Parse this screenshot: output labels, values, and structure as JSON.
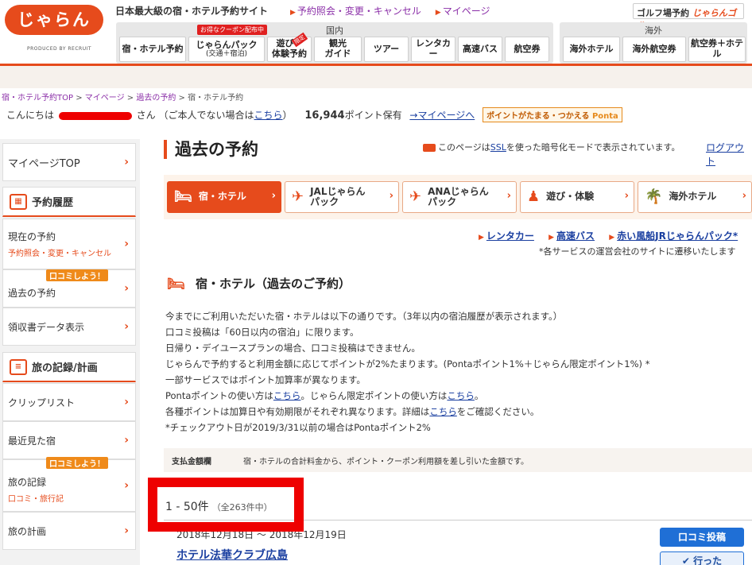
{
  "header": {
    "logo_text": "じゃらん",
    "logo_sub": "PRODUCED BY RECRUIT",
    "tagline": "日本最大級の宿・ホテル予約サイト",
    "top_links": [
      "予約照会・変更・キャンセル",
      "マイページ"
    ],
    "golf_label": "ゴルフ場予約",
    "golf_brand": "じゃらんゴルフ",
    "domestic_label": "国内",
    "overseas_label": "海外",
    "coupon_badge": "お得なクーポン配布中",
    "gen_badge": "限定",
    "domestic_tabs": [
      {
        "label": "宿・ホテル予約",
        "sub": ""
      },
      {
        "label": "じゃらんパック",
        "sub": "(交通＋宿泊)"
      },
      {
        "label": "遊び・",
        "sub": "体験予約"
      },
      {
        "label": "観光",
        "sub": "ガイド"
      },
      {
        "label": "ツアー",
        "sub": ""
      },
      {
        "label": "レンタカー",
        "sub": ""
      },
      {
        "label": "高速バス",
        "sub": ""
      },
      {
        "label": "航空券",
        "sub": ""
      }
    ],
    "overseas_tabs": [
      {
        "label": "海外ホテル"
      },
      {
        "label": "海外航空券"
      },
      {
        "label": "航空券＋ホテル"
      }
    ]
  },
  "breadcrumb": {
    "items": [
      "宿・ホテル予約TOP",
      "マイページ",
      "過去の予約"
    ],
    "current": "宿・ホテル予約",
    "sep": " > "
  },
  "greeting": {
    "hello": "こんにちは",
    "san": "さん",
    "not_you": "（ご本人でない場合は",
    "kochira": "こちら",
    "close": "）",
    "points": "16,944",
    "points_suffix": "ポイント保有",
    "mypage_link": "→マイページへ",
    "ponta_text": "ポイントがたまる・つかえる",
    "ponta_brand": "Ponta"
  },
  "sidebar": {
    "mypage_top": "マイページTOP",
    "section1": "予約履歴",
    "current_res": "現在の予約",
    "current_res_sub": "予約照会・変更・キャンセル",
    "kuchikomi_badge": "口コミしよう！",
    "past_res": "過去の予約",
    "receipt": "領収書データ表示",
    "section2": "旅の記録/計画",
    "clip": "クリップリスト",
    "recent": "最近見た宿",
    "travel_record": "旅の記録",
    "travel_record_sub": "口コミ・旅行記",
    "travel_plan": "旅の計画",
    "chev": "›"
  },
  "main": {
    "title": "過去の予約",
    "ssl_note_pre": "このページは",
    "ssl_link": "SSL",
    "ssl_note_post": "を使った暗号化モードで表示されています。",
    "logout": "ログアウト",
    "service_tabs": [
      {
        "icon": "bed-icon",
        "label1": "宿・ホテル",
        "label2": "",
        "active": true
      },
      {
        "icon": "plane-icon",
        "label1": "JALじゃらん",
        "label2": "パック",
        "active": false
      },
      {
        "icon": "plane-icon",
        "label1": "ANAじゃらん",
        "label2": "パック",
        "active": false
      },
      {
        "icon": "play-icon",
        "label1": "遊び・体験",
        "label2": "",
        "active": false
      },
      {
        "icon": "palm-icon",
        "label1": "海外ホテル",
        "label2": "",
        "active": false
      }
    ],
    "ext_links": [
      "レンタカー",
      "高速バス",
      "赤い風船JRじゃらんパック*"
    ],
    "ext_note": "*各サービスの運営会社のサイトに遷移いたします",
    "section_title": "宿・ホテル（過去のご予約）",
    "notes": [
      "今までにご利用いただいた宿・ホテルは以下の通りです。（3年以内の宿泊履歴が表示されます。）",
      "口コミ投稿は「60日以内の宿泊」に限ります。",
      "日帰り・デイユースプランの場合、口コミ投稿はできません。",
      "じゃらんで予約すると利用金額に応じてポイントが2%たまります。(Pontaポイント1%＋じゃらん限定ポイント1%) *",
      "一部サービスではポイント加算率が異なります。"
    ],
    "ponta_use_pre": "Pontaポイントの使い方は",
    "ponta_use_link": "こちら",
    "ponta_use_mid": "。じゃらん限定ポイントの使い方は",
    "jalan_use_link": "こちら",
    "ponta_use_post": "。",
    "points_detail_pre": "各種ポイントは加算日や有効期限がそれぞれ異なります。詳細は",
    "points_detail_link": "こちら",
    "points_detail_post": "をご確認ください。",
    "checkout_note": "*チェックアウト日が2019/3/31以前の場合はPontaポイント2%",
    "pay_label": "支払金額欄",
    "pay_desc": "宿・ホテルの合計料金から、ポイント・クーポン利用額を差し引いた金額です。",
    "count": "1 - 50件",
    "count_total": "（全263件中）",
    "dates": "2018年12月18日 ～ 2018年12月19日",
    "hotel_name": "ホテル法華クラブ広島",
    "btn_review": "口コミ投稿",
    "btn_went": "✔ 行った"
  }
}
